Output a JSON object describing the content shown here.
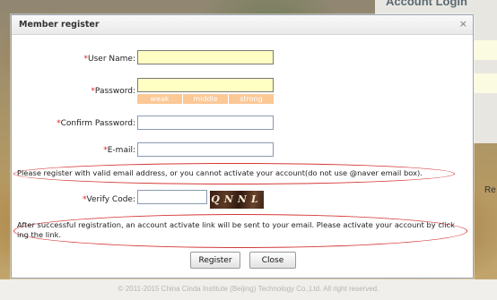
{
  "background": {
    "panel_title": "Account Login",
    "side_text": "Re",
    "footer": "© 2011-2015 China Cinda Institute (Beijing) Technology Co.,Ltd. All right reserved."
  },
  "dialog": {
    "title": "Member register",
    "close_symbol": "×",
    "required_mark": "*",
    "username_label": "User Name:",
    "username_value": "",
    "password_label": "Password:",
    "password_value": "",
    "strength": [
      "weak",
      "middle",
      "strong"
    ],
    "confirm_label": "Confirm Password:",
    "confirm_value": "",
    "email_label": "E-mail:",
    "email_value": "",
    "email_notice": "Please register with valid email address, or you cannot activate your account(do not use @naver email box).",
    "verify_label": "Verify Code:",
    "verify_value": "",
    "captcha_text": "QNNL",
    "activation_notice_line1": "After successful registration, an account activate link will be sent to your email. Please activate your account by click",
    "activation_notice_line2": "ing the link.",
    "register_button": "Register",
    "close_button": "Close"
  },
  "colors": {
    "required": "#e02020",
    "highlight_field": "#ffffc4",
    "strength_bar": "#fbc896",
    "annotation_ellipse": "#d63838"
  }
}
